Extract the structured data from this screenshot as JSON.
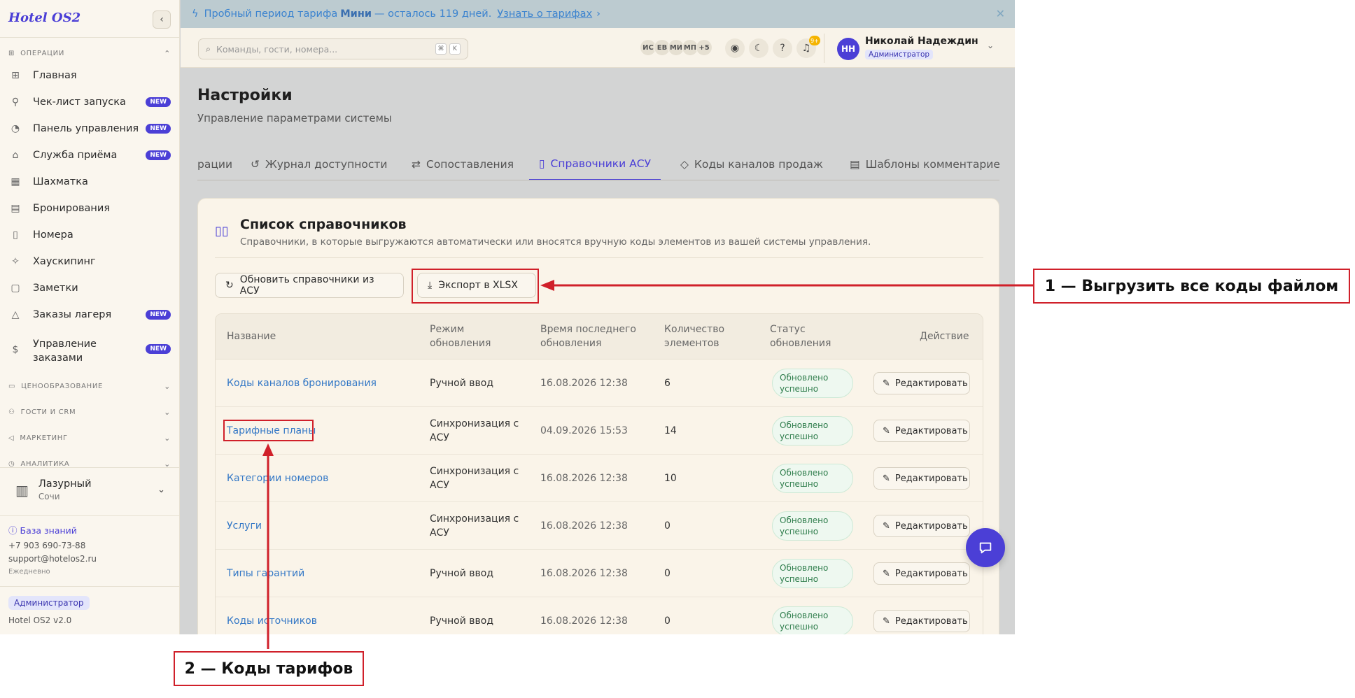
{
  "brand": "Hotel OS2",
  "sidebar": {
    "sections": [
      {
        "label": "ОПЕРАЦИИ"
      },
      {
        "label": "ЦЕНООБРАЗОВАНИЕ"
      },
      {
        "label": "ГОСТИ И CRM"
      },
      {
        "label": "МАРКЕТИНГ"
      },
      {
        "label": "АНАЛИТИКА"
      }
    ],
    "items": [
      {
        "label": "Главная",
        "icon": "grid-icon",
        "badge": ""
      },
      {
        "label": "Чек-лист запуска",
        "icon": "rocket-icon",
        "badge": "NEW"
      },
      {
        "label": "Панель управления",
        "icon": "gauge-icon",
        "badge": "NEW"
      },
      {
        "label": "Служба приёма",
        "icon": "bell-icon",
        "badge": "NEW"
      },
      {
        "label": "Шахматка",
        "icon": "table-icon",
        "badge": ""
      },
      {
        "label": "Бронирования",
        "icon": "clipboard-icon",
        "badge": ""
      },
      {
        "label": "Номера",
        "icon": "door-icon",
        "badge": ""
      },
      {
        "label": "Хаускипинг",
        "icon": "sparkle-icon",
        "badge": ""
      },
      {
        "label": "Заметки",
        "icon": "note-icon",
        "badge": ""
      },
      {
        "label": "Заказы лагеря",
        "icon": "tent-icon",
        "badge": "NEW"
      },
      {
        "label": "Управление заказами",
        "icon": "receipt-icon",
        "badge": "NEW"
      }
    ],
    "hotel": {
      "name": "Лазурный",
      "city": "Сочи"
    },
    "kb_link": "База знаний",
    "phone": "+7 903 690-73-88",
    "email": "support@hotelos2.ru",
    "schedule": "Ежедневно",
    "role": "Администратор",
    "version": "Hotel OS2 v2.0"
  },
  "banner": {
    "prefix": "Пробный период тарифа",
    "plan": "Мини",
    "suffix": "— осталось 119 дней.",
    "link": "Узнать о тарифах",
    "link_arrow": "›"
  },
  "topbar": {
    "search_placeholder": "Команды, гости, номера...",
    "kbd1": "⌘",
    "kbd2": "K",
    "avatars": [
      "ИС",
      "ЕВ",
      "МИ",
      "МП",
      "+5"
    ],
    "notif_count": "9+",
    "user_initials": "НН",
    "user_name": "Николай Надеждин",
    "user_role": "Администратор"
  },
  "page": {
    "title": "Настройки",
    "subtitle": "Управление параметрами системы",
    "tabs": [
      {
        "label": "рации",
        "icon": ""
      },
      {
        "label": "Журнал доступности",
        "icon": "history-icon"
      },
      {
        "label": "Сопоставления",
        "icon": "arrows-icon"
      },
      {
        "label": "Справочники АСУ",
        "icon": "book-icon"
      },
      {
        "label": "Коды каналов продаж",
        "icon": "tag-icon"
      },
      {
        "label": "Шаблоны комментариев",
        "icon": "doc-icon"
      }
    ]
  },
  "card": {
    "title": "Список справочников",
    "subtitle": "Справочники, в которые выгружаются автоматически или вносятся вручную коды элементов из вашей системы управления.",
    "refresh_btn": "Обновить справочники из АСУ",
    "export_btn": "Экспорт в XLSX",
    "columns": {
      "name": "Название",
      "mode": [
        "Режим",
        "обновления"
      ],
      "time": [
        "Время последнего",
        "обновления"
      ],
      "count": [
        "Количество",
        "элементов"
      ],
      "status": [
        "Статус",
        "обновления"
      ],
      "action": "Действие"
    },
    "rows": [
      {
        "name": "Коды каналов бронирования",
        "mode": [
          "Ручной ввод"
        ],
        "time": "16.08.2026 12:38",
        "count": "6",
        "status": [
          "Обновлено",
          "успешно"
        ],
        "action": "Редактировать"
      },
      {
        "name": "Тарифные планы",
        "mode": [
          "Синхронизация с",
          "АСУ"
        ],
        "time": "04.09.2026 15:53",
        "count": "14",
        "status": [
          "Обновлено",
          "успешно"
        ],
        "action": "Редактировать"
      },
      {
        "name": "Категории номеров",
        "mode": [
          "Синхронизация с",
          "АСУ"
        ],
        "time": "16.08.2026 12:38",
        "count": "10",
        "status": [
          "Обновлено",
          "успешно"
        ],
        "action": "Редактировать"
      },
      {
        "name": "Услуги",
        "mode": [
          "Синхронизация с",
          "АСУ"
        ],
        "time": "16.08.2026 12:38",
        "count": "0",
        "status": [
          "Обновлено",
          "успешно"
        ],
        "action": "Редактировать"
      },
      {
        "name": "Типы гарантий",
        "mode": [
          "Ручной ввод"
        ],
        "time": "16.08.2026 12:38",
        "count": "0",
        "status": [
          "Обновлено",
          "успешно"
        ],
        "action": "Редактировать"
      },
      {
        "name": "Коды источников",
        "mode": [
          "Ручной ввод"
        ],
        "time": "16.08.2026 12:38",
        "count": "0",
        "status": [
          "Обновлено",
          "успешно"
        ],
        "action": "Редактировать"
      }
    ]
  },
  "annotations": {
    "export_label": "1 — Выгрузить все коды файлом",
    "tariff_label": "2 — Коды тарифов",
    "color": "#d0202a"
  },
  "colors": {
    "accent": "#4b3fd6",
    "link": "#3478c6",
    "success": "#2f7d4c"
  }
}
